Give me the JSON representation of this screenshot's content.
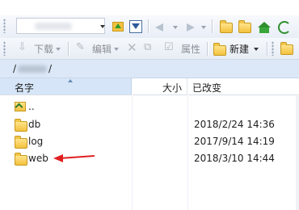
{
  "toolbar": {
    "download_label": "下载",
    "edit_label": "编辑",
    "properties_label": "属性",
    "new_label": "新建",
    "delete_icon": "x-icon"
  },
  "path": {
    "prefix": "/",
    "suffix": "/"
  },
  "columns": {
    "name": "名字",
    "size": "大小",
    "modified": "已改变"
  },
  "files": [
    {
      "name": "..",
      "date": "",
      "type": "parent"
    },
    {
      "name": "db",
      "date": "2018/2/24 14:36",
      "type": "folder"
    },
    {
      "name": "log",
      "date": "2017/9/14 14:19",
      "type": "folder"
    },
    {
      "name": "web",
      "date": "2018/3/10 14:44",
      "type": "folder"
    }
  ],
  "annotation": {
    "color": "#e02020",
    "points_to": "web"
  }
}
